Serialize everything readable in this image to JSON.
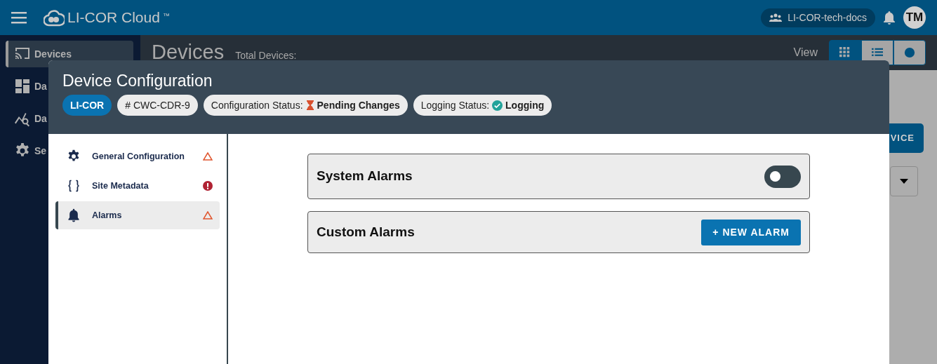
{
  "topbar": {
    "app_title": "LI-COR Cloud",
    "trademark": "™",
    "org": "LI-COR-tech-docs",
    "avatar": "TM"
  },
  "sidebar": {
    "items": [
      {
        "label": "Devices",
        "selected": true
      },
      {
        "label": "Da",
        "selected": false
      },
      {
        "label": "Da",
        "selected": false
      },
      {
        "label": "Se",
        "selected": false
      }
    ]
  },
  "page": {
    "title": "Devices",
    "total_label": "Total Devices:",
    "view_label": "View",
    "views": [
      {
        "selected": true
      },
      {
        "selected": false
      },
      {
        "selected": false
      }
    ],
    "add_button": "VICE"
  },
  "modal": {
    "title": "Device Configuration",
    "chips": [
      {
        "kind": "brand",
        "text": "LI-COR"
      },
      {
        "kind": "plain",
        "text": "# CWC-CDR-9"
      },
      {
        "kind": "pending",
        "label": "Configuration Status:",
        "value": "Pending Changes"
      },
      {
        "kind": "done",
        "label": "Logging Status:",
        "value": "Logging"
      }
    ],
    "nav": [
      {
        "kind": "warning",
        "label": "General Configuration",
        "selected": false
      },
      {
        "kind": "error",
        "label": "Site Metadata",
        "selected": false
      },
      {
        "kind": "warning",
        "label": "Alarms",
        "selected": true
      }
    ],
    "sections": [
      {
        "kind": "toggle",
        "title": "System Alarms",
        "on": false
      },
      {
        "kind": "button",
        "title": "Custom Alarms",
        "button": "+ NEW ALARM"
      }
    ]
  }
}
